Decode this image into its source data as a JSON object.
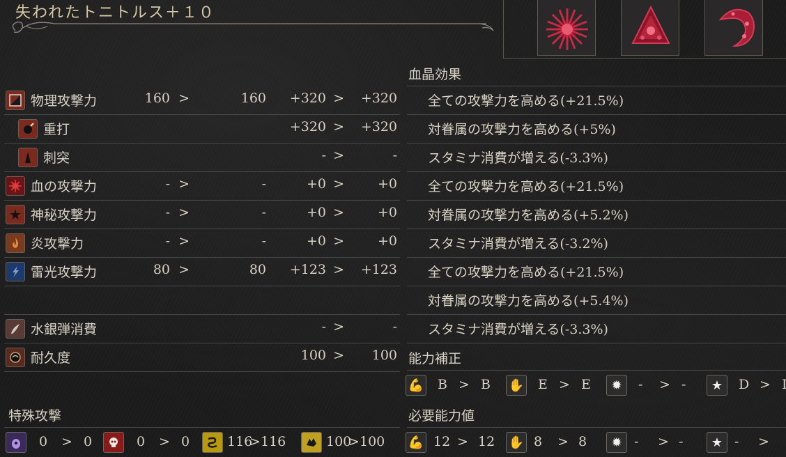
{
  "title": "失われたトニトルス＋１０",
  "gems": [
    {
      "name": "gem-radial-icon"
    },
    {
      "name": "gem-triangle-icon"
    },
    {
      "name": "gem-waning-icon"
    }
  ],
  "sections": {
    "blood_gem_effects": "血晶効果",
    "scaling": "能力補正",
    "requirements": "必要能力値",
    "special_attack": "特殊攻撃"
  },
  "attack_rows": [
    {
      "label": "物理攻撃力",
      "icon": "physical-attack-icon",
      "a": "160",
      "a_arrow": ">",
      "b": "160",
      "c": "+320",
      "c_arrow": ">",
      "d": "+320"
    },
    {
      "label": "重打",
      "icon": "blunt-icon",
      "a": "",
      "a_arrow": "",
      "b": "",
      "c": "+320",
      "c_arrow": ">",
      "d": "+320"
    },
    {
      "label": "刺突",
      "icon": "thrust-icon",
      "a": "",
      "a_arrow": "",
      "b": "",
      "c": "-",
      "c_arrow": ">",
      "d": "-"
    },
    {
      "label": "血の攻撃力",
      "icon": "blood-attack-icon",
      "a": "-",
      "a_arrow": ">",
      "b": "-",
      "c": "+0",
      "c_arrow": ">",
      "d": "+0"
    },
    {
      "label": "神秘攻撃力",
      "icon": "arcane-attack-icon",
      "a": "-",
      "a_arrow": ">",
      "b": "-",
      "c": "+0",
      "c_arrow": ">",
      "d": "+0"
    },
    {
      "label": "炎攻撃力",
      "icon": "fire-attack-icon",
      "a": "-",
      "a_arrow": ">",
      "b": "-",
      "c": "+0",
      "c_arrow": ">",
      "d": "+0"
    },
    {
      "label": "雷光攻撃力",
      "icon": "bolt-attack-icon",
      "a": "80",
      "a_arrow": ">",
      "b": "80",
      "c": "+123",
      "c_arrow": ">",
      "d": "+123"
    },
    {
      "label": "",
      "icon": "",
      "a": "",
      "a_arrow": "",
      "b": "",
      "c": "",
      "c_arrow": "",
      "d": ""
    },
    {
      "label": "水銀弾消費",
      "icon": "quicksilver-icon",
      "a": "",
      "a_arrow": "",
      "b": "",
      "c": "-",
      "c_arrow": ">",
      "d": "-"
    },
    {
      "label": "耐久度",
      "icon": "durability-icon",
      "a": "",
      "a_arrow": "",
      "b": "",
      "c": "100",
      "c_arrow": ">",
      "d": "100"
    }
  ],
  "effects": [
    "全ての攻撃力を高める(+21.5%)",
    "対眷属の攻撃力を高める(+5%)",
    "スタミナ消費が増える(-3.3%)",
    "全ての攻撃力を高める(+21.5%)",
    "対眷属の攻撃力を高める(+5.2%)",
    "スタミナ消費が増える(-3.2%)",
    "全ての攻撃力を高める(+21.5%)",
    "対眷属の攻撃力を高める(+5.4%)",
    "スタミナ消費が増える(-3.3%)"
  ],
  "scaling": [
    {
      "icon": "strength-icon",
      "from": "B",
      "arrow": ">",
      "to": "B"
    },
    {
      "icon": "skill-icon",
      "from": "E",
      "arrow": ">",
      "to": "E"
    },
    {
      "icon": "bloodtinge-icon",
      "from": "-",
      "arrow": ">",
      "to": "-"
    },
    {
      "icon": "arcane-icon",
      "from": "D",
      "arrow": ">",
      "to": "D"
    }
  ],
  "requirements": [
    {
      "icon": "strength-icon",
      "from": "12",
      "arrow": ">",
      "to": "12"
    },
    {
      "icon": "skill-icon",
      "from": "8",
      "arrow": ">",
      "to": "8"
    },
    {
      "icon": "bloodtinge-icon",
      "from": "-",
      "arrow": ">",
      "to": "-"
    },
    {
      "icon": "arcane-icon",
      "from": "-",
      "arrow": ">",
      "to": ""
    }
  ],
  "special_attacks": [
    {
      "icon": "kin-icon",
      "from": "0",
      "arrow": ">",
      "to": "0"
    },
    {
      "icon": "human-skull-icon",
      "from": "0",
      "arrow": ">",
      "to": "0"
    },
    {
      "icon": "serpent-icon",
      "from": "116",
      "arrow": ">",
      "to": "116"
    },
    {
      "icon": "beast-icon",
      "from": "100",
      "arrow": ">",
      "to": "100"
    }
  ],
  "colors": {
    "panel_bg": "#1b1b1b",
    "title_gold": "#d7c9a4",
    "text": "#d8d2c4",
    "divider": "#4a4744",
    "gem_red": "#b3243a"
  }
}
